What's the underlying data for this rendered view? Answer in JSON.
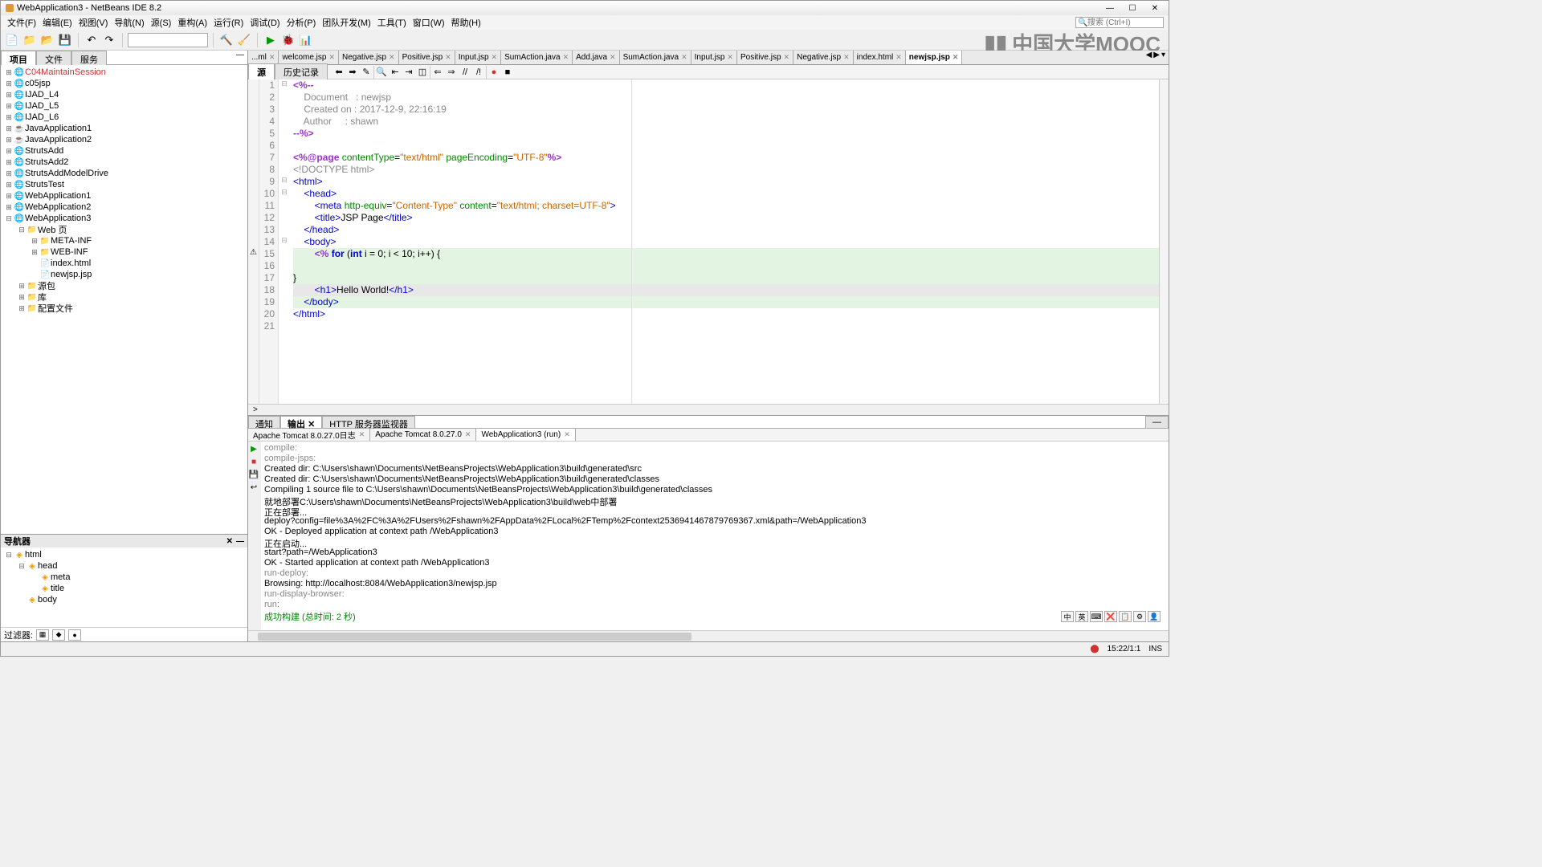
{
  "title": "WebApplication3 - NetBeans IDE 8.2",
  "menus": [
    "文件(F)",
    "编辑(E)",
    "视图(V)",
    "导航(N)",
    "源(S)",
    "重构(A)",
    "运行(R)",
    "调试(D)",
    "分析(P)",
    "团队开发(M)",
    "工具(T)",
    "窗口(W)",
    "帮助(H)"
  ],
  "search_placeholder": "搜索 (Ctrl+I)",
  "watermark": "中国大学MOOC",
  "left": {
    "tabs": [
      "项目",
      "文件",
      "服务"
    ],
    "projects": [
      {
        "i": 0,
        "open": false,
        "badge": true,
        "label": "C04MaintainSession",
        "cls": "red"
      },
      {
        "i": 0,
        "open": false,
        "badge": true,
        "label": "c05jsp"
      },
      {
        "i": 0,
        "open": false,
        "badge": true,
        "label": "IJAD_L4"
      },
      {
        "i": 0,
        "open": false,
        "badge": true,
        "label": "IJAD_L5"
      },
      {
        "i": 0,
        "open": false,
        "badge": true,
        "label": "IJAD_L6"
      },
      {
        "i": 0,
        "open": false,
        "badge": true,
        "label": "JavaApplication1",
        "icon": "coffee"
      },
      {
        "i": 0,
        "open": false,
        "badge": true,
        "label": "JavaApplication2",
        "icon": "coffee"
      },
      {
        "i": 0,
        "open": false,
        "badge": true,
        "label": "StrutsAdd"
      },
      {
        "i": 0,
        "open": false,
        "badge": true,
        "label": "StrutsAdd2"
      },
      {
        "i": 0,
        "open": false,
        "badge": true,
        "label": "StrutsAddModelDrive"
      },
      {
        "i": 0,
        "open": false,
        "badge": true,
        "label": "StrutsTest"
      },
      {
        "i": 0,
        "open": false,
        "badge": true,
        "label": "WebApplication1"
      },
      {
        "i": 0,
        "open": false,
        "badge": true,
        "label": "WebApplication2"
      },
      {
        "i": 0,
        "open": true,
        "badge": true,
        "label": "WebApplication3"
      },
      {
        "i": 1,
        "open": true,
        "label": "Web 页",
        "icon": "folder"
      },
      {
        "i": 2,
        "open": false,
        "label": "META-INF",
        "icon": "folder"
      },
      {
        "i": 2,
        "open": false,
        "label": "WEB-INF",
        "icon": "folder"
      },
      {
        "i": 2,
        "leaf": true,
        "label": "index.html",
        "icon": "file"
      },
      {
        "i": 2,
        "leaf": true,
        "label": "newjsp.jsp",
        "icon": "file"
      },
      {
        "i": 1,
        "open": false,
        "label": "源包",
        "icon": "folder"
      },
      {
        "i": 1,
        "open": false,
        "label": "库",
        "icon": "folder"
      },
      {
        "i": 1,
        "open": false,
        "label": "配置文件",
        "icon": "folder"
      }
    ],
    "nav_title": "导航器",
    "nav_items": [
      {
        "i": 0,
        "open": true,
        "label": "html"
      },
      {
        "i": 1,
        "open": true,
        "label": "head"
      },
      {
        "i": 2,
        "leaf": true,
        "label": "meta"
      },
      {
        "i": 2,
        "leaf": true,
        "label": "title"
      },
      {
        "i": 1,
        "leaf": true,
        "label": "body"
      }
    ],
    "filter_label": "过滤器:"
  },
  "editor": {
    "tabs": [
      {
        "label": "...ml"
      },
      {
        "label": "welcome.jsp"
      },
      {
        "label": "Negative.jsp"
      },
      {
        "label": "Positive.jsp"
      },
      {
        "label": "Input.jsp"
      },
      {
        "label": "SumAction.java"
      },
      {
        "label": "Add.java"
      },
      {
        "label": "SumAction.java"
      },
      {
        "label": "Input.jsp"
      },
      {
        "label": "Positive.jsp"
      },
      {
        "label": "Negative.jsp"
      },
      {
        "label": "index.html"
      },
      {
        "label": "newjsp.jsp",
        "active": true
      }
    ],
    "subtabs": [
      "源",
      "历史记录"
    ],
    "code": [
      {
        "n": 1,
        "hl": "",
        "tokens": [
          [
            "c-jsp",
            "<%--"
          ]
        ]
      },
      {
        "n": 2,
        "hl": "",
        "tokens": [
          [
            "c-cmt",
            "    Document   : newjsp"
          ]
        ]
      },
      {
        "n": 3,
        "hl": "",
        "tokens": [
          [
            "c-cmt",
            "    Created on : 2017-12-9, 22:16:19"
          ]
        ]
      },
      {
        "n": 4,
        "hl": "",
        "tokens": [
          [
            "c-cmt",
            "    Author     : shawn"
          ]
        ]
      },
      {
        "n": 5,
        "hl": "",
        "tokens": [
          [
            "c-jsp",
            "--%>"
          ]
        ]
      },
      {
        "n": 6,
        "hl": "",
        "tokens": [
          [
            "",
            ""
          ]
        ]
      },
      {
        "n": 7,
        "hl": "",
        "tokens": [
          [
            "c-jsp",
            "<%@page"
          ],
          [
            "",
            " "
          ],
          [
            "c-attr",
            "contentType"
          ],
          [
            "",
            "="
          ],
          [
            "c-str",
            "\"text/html\""
          ],
          [
            "",
            " "
          ],
          [
            "c-attr",
            "pageEncoding"
          ],
          [
            "",
            "="
          ],
          [
            "c-str",
            "\"UTF-8\""
          ],
          [
            "c-jsp",
            "%>"
          ]
        ]
      },
      {
        "n": 8,
        "hl": "",
        "tokens": [
          [
            "c-cmt",
            "<!DOCTYPE html>"
          ]
        ]
      },
      {
        "n": 9,
        "hl": "",
        "tokens": [
          [
            "c-tag",
            "<html>"
          ]
        ]
      },
      {
        "n": 10,
        "hl": "",
        "tokens": [
          [
            "",
            "    "
          ],
          [
            "c-tag",
            "<head>"
          ]
        ]
      },
      {
        "n": 11,
        "hl": "",
        "tokens": [
          [
            "",
            "        "
          ],
          [
            "c-tag",
            "<meta"
          ],
          [
            "",
            " "
          ],
          [
            "c-attr",
            "http-equiv"
          ],
          [
            "",
            "="
          ],
          [
            "c-str",
            "\"Content-Type\""
          ],
          [
            "",
            " "
          ],
          [
            "c-attr",
            "content"
          ],
          [
            "",
            "="
          ],
          [
            "c-str",
            "\"text/html; charset=UTF-8\""
          ],
          [
            "c-tag",
            ">"
          ]
        ]
      },
      {
        "n": 12,
        "hl": "",
        "tokens": [
          [
            "",
            "        "
          ],
          [
            "c-tag",
            "<title>"
          ],
          [
            "",
            "JSP Page"
          ],
          [
            "c-tag",
            "</title>"
          ]
        ]
      },
      {
        "n": 13,
        "hl": "",
        "tokens": [
          [
            "",
            "    "
          ],
          [
            "c-tag",
            "</head>"
          ]
        ]
      },
      {
        "n": 14,
        "hl": "",
        "tokens": [
          [
            "",
            "    "
          ],
          [
            "c-tag",
            "<body>"
          ]
        ]
      },
      {
        "n": 15,
        "hl": "green",
        "mark": "⚠",
        "tokens": [
          [
            "",
            "        "
          ],
          [
            "c-jsp",
            "<%"
          ],
          [
            "",
            " "
          ],
          [
            "c-kw",
            "for"
          ],
          [
            "",
            " ("
          ],
          [
            "c-kw",
            "int"
          ],
          [
            "",
            " i = 0; i < 10; i++) {"
          ]
        ]
      },
      {
        "n": 16,
        "hl": "green",
        "tokens": [
          [
            "",
            ""
          ]
        ]
      },
      {
        "n": 17,
        "hl": "green",
        "tokens": [
          [
            "",
            "}"
          ]
        ]
      },
      {
        "n": 18,
        "hl": "current",
        "tokens": [
          [
            "",
            "        "
          ],
          [
            "c-tag",
            "<h1>"
          ],
          [
            "",
            "Hello World!"
          ],
          [
            "c-tag",
            "</h1>"
          ]
        ]
      },
      {
        "n": 19,
        "hl": "green",
        "tokens": [
          [
            "",
            "    "
          ],
          [
            "c-tag",
            "</body>"
          ]
        ]
      },
      {
        "n": 20,
        "hl": "",
        "tokens": [
          [
            "c-tag",
            "</html>"
          ]
        ]
      },
      {
        "n": 21,
        "hl": "",
        "tokens": [
          [
            "",
            ""
          ]
        ]
      }
    ]
  },
  "output": {
    "top_tabs": [
      "通知",
      "输出",
      "HTTP 服务器监视器"
    ],
    "sub_tabs": [
      {
        "label": "Apache Tomcat 8.0.27.0日志"
      },
      {
        "label": "Apache Tomcat 8.0.27.0"
      },
      {
        "label": "WebApplication3 (run)",
        "active": true
      }
    ],
    "lines": [
      {
        "cls": "gray",
        "t": "compile:"
      },
      {
        "cls": "gray",
        "t": "compile-jsps:"
      },
      {
        "cls": "",
        "t": "Created dir: C:\\Users\\shawn\\Documents\\NetBeansProjects\\WebApplication3\\build\\generated\\src"
      },
      {
        "cls": "",
        "t": "Created dir: C:\\Users\\shawn\\Documents\\NetBeansProjects\\WebApplication3\\build\\generated\\classes"
      },
      {
        "cls": "",
        "t": "Compiling 1 source file to C:\\Users\\shawn\\Documents\\NetBeansProjects\\WebApplication3\\build\\generated\\classes"
      },
      {
        "cls": "",
        "t": "就地部署C:\\Users\\shawn\\Documents\\NetBeansProjects\\WebApplication3\\build\\web中部署"
      },
      {
        "cls": "",
        "t": "正在部署..."
      },
      {
        "cls": "",
        "t": "deploy?config=file%3A%2FC%3A%2FUsers%2Fshawn%2FAppData%2FLocal%2FTemp%2Fcontext2536941467879769367.xml&path=/WebApplication3"
      },
      {
        "cls": "",
        "t": "OK - Deployed application at context path /WebApplication3"
      },
      {
        "cls": "",
        "t": "正在启动..."
      },
      {
        "cls": "",
        "t": "start?path=/WebApplication3"
      },
      {
        "cls": "",
        "t": "OK - Started application at context path /WebApplication3"
      },
      {
        "cls": "gray",
        "t": "run-deploy:"
      },
      {
        "cls": "",
        "t": "Browsing: http://localhost:8084/WebApplication3/newjsp.jsp"
      },
      {
        "cls": "gray",
        "t": "run-display-browser:"
      },
      {
        "cls": "gray",
        "t": "run:"
      },
      {
        "cls": "green",
        "t": "成功构建 (总时间: 2 秒)"
      }
    ],
    "ime_btns": [
      "中",
      "英",
      "⌨",
      "❌",
      "📋",
      "⚙",
      "👤"
    ]
  },
  "status": {
    "left": "",
    "cursor": "15:22/1:1",
    "ins": "INS"
  }
}
